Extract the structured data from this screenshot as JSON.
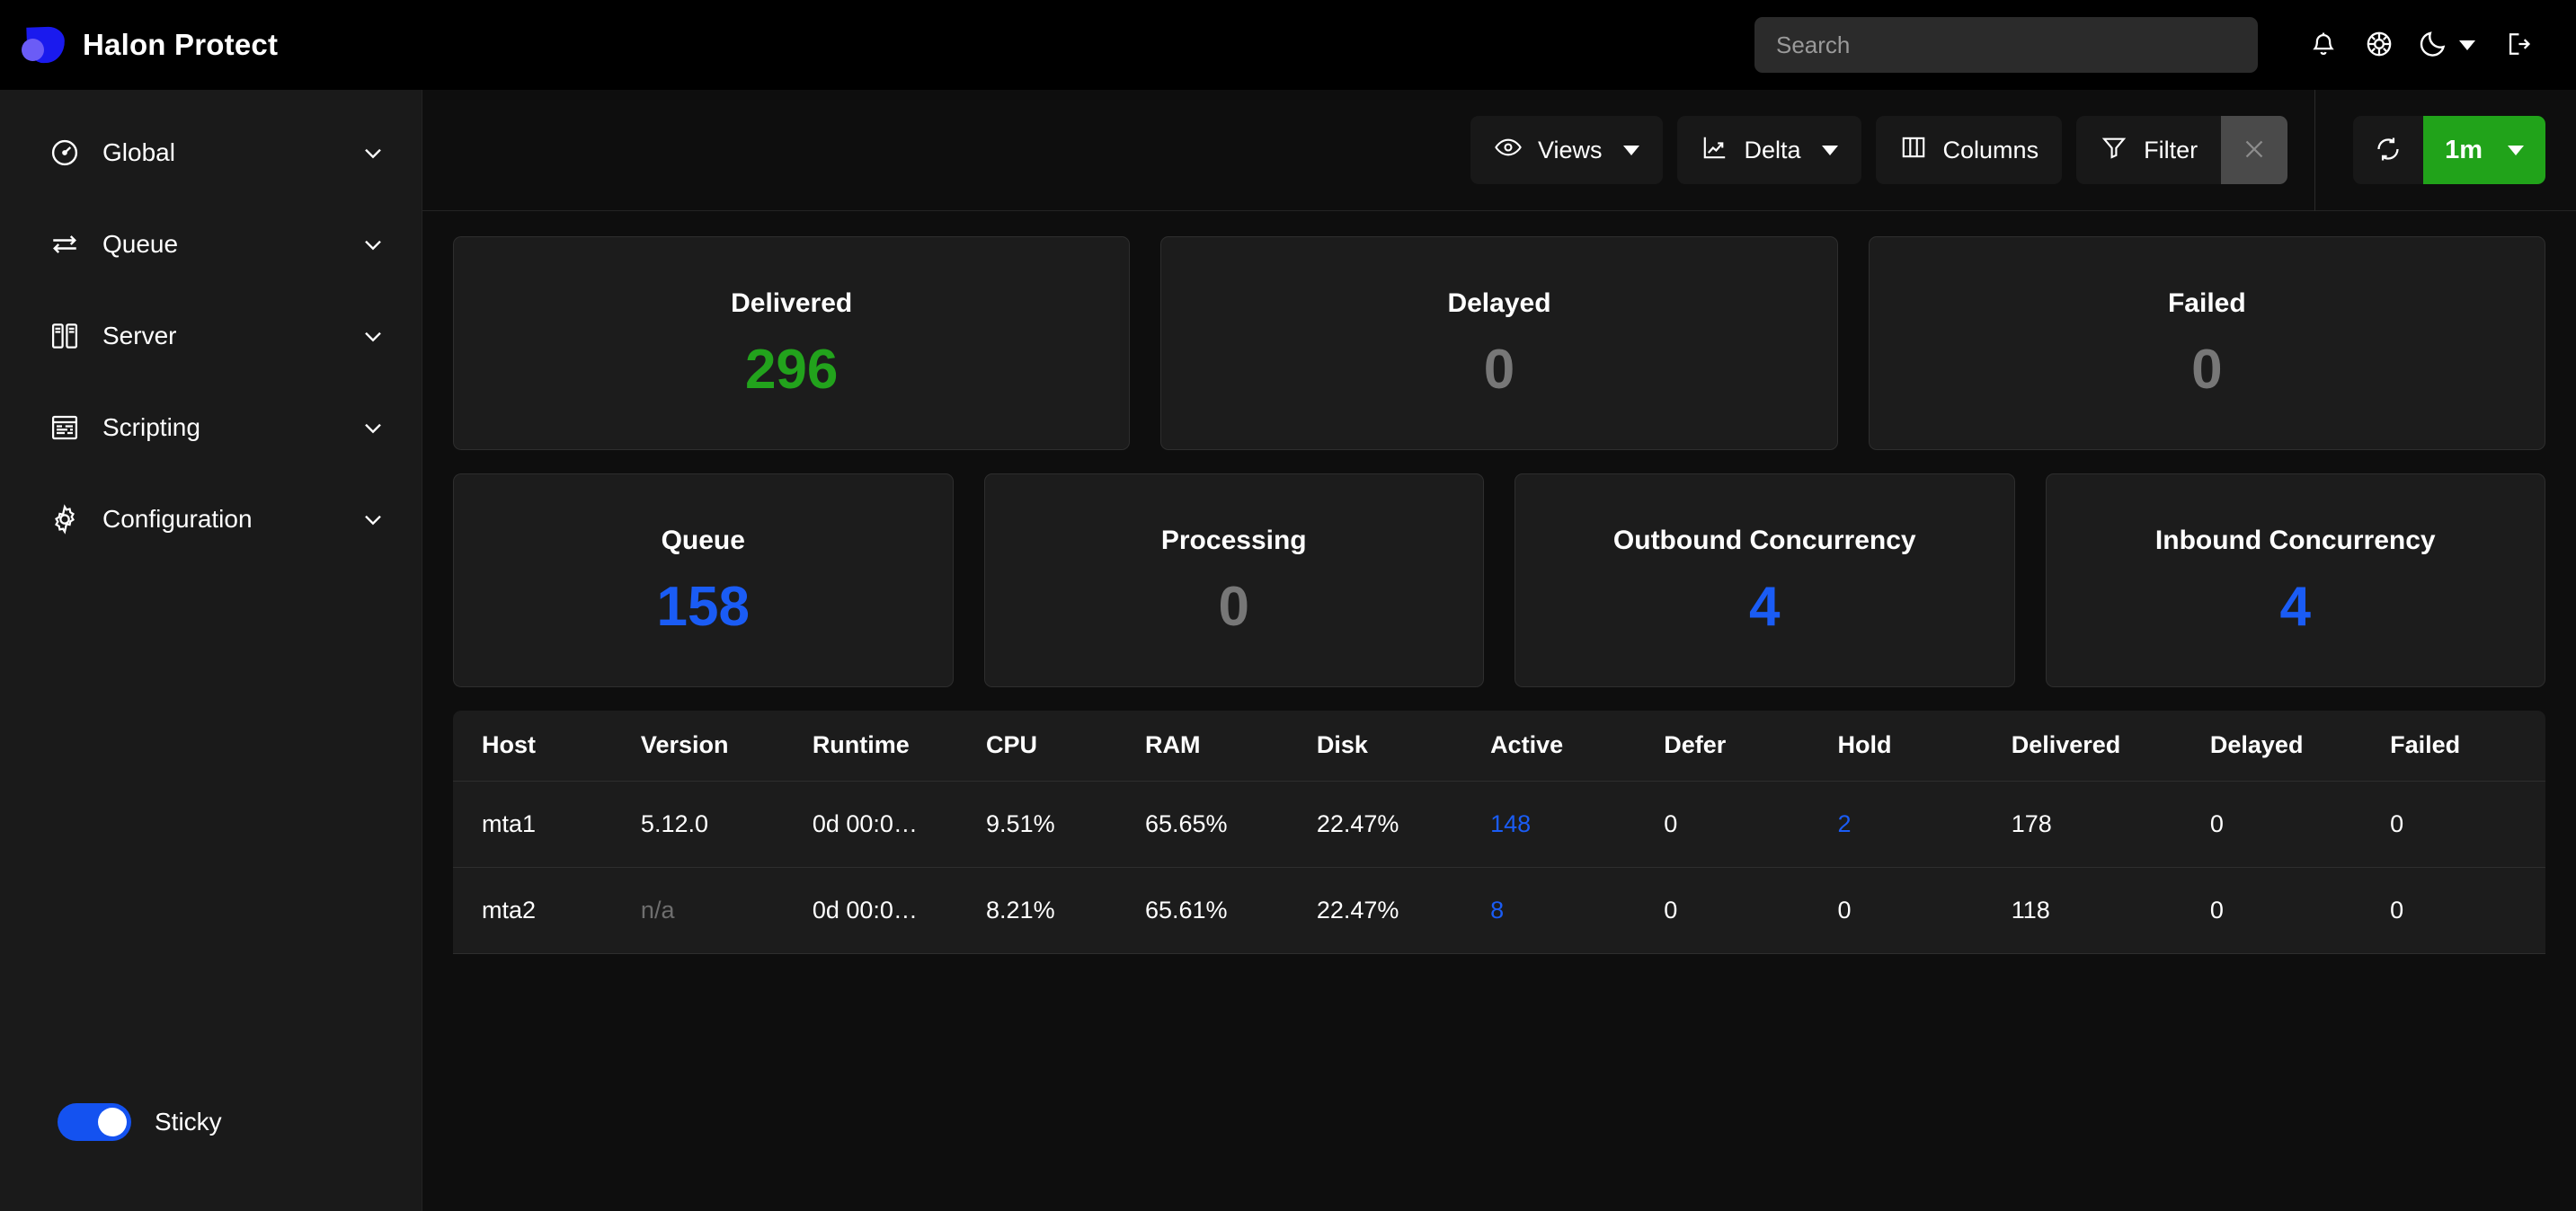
{
  "app": {
    "brand_title": "Halon Protect",
    "logo_color": "#1a1aee",
    "logo_dot_color": "#6b5cf6"
  },
  "header": {
    "search_placeholder": "Search",
    "search_value": "",
    "icons": {
      "notifications": "bell-icon",
      "help": "lifebuoy-icon",
      "theme": "moon-icon",
      "theme_caret": "chevron-down-icon",
      "logout": "logout-icon"
    }
  },
  "sidebar": {
    "items": [
      {
        "label": "Global",
        "icon": "gauge-icon"
      },
      {
        "label": "Queue",
        "icon": "swap-arrows-icon"
      },
      {
        "label": "Server",
        "icon": "servers-icon"
      },
      {
        "label": "Scripting",
        "icon": "script-window-icon"
      },
      {
        "label": "Configuration",
        "icon": "gear-icon"
      }
    ],
    "sticky": {
      "label": "Sticky",
      "enabled": true,
      "color": "#1452f0"
    }
  },
  "toolbar": {
    "views_label": "Views",
    "delta_label": "Delta",
    "columns_label": "Columns",
    "filter_label": "Filter",
    "filter_clear_label": "×",
    "refresh_icon": "refresh-icon",
    "interval_label": "1m",
    "interval_color": "#21a31a"
  },
  "stats": {
    "row1": [
      {
        "title": "Delivered",
        "value": "296",
        "tone": "green"
      },
      {
        "title": "Delayed",
        "value": "0",
        "tone": "gray"
      },
      {
        "title": "Failed",
        "value": "0",
        "tone": "gray"
      }
    ],
    "row2": [
      {
        "title": "Queue",
        "value": "158",
        "tone": "blue"
      },
      {
        "title": "Processing",
        "value": "0",
        "tone": "gray"
      },
      {
        "title": "Outbound Concurrency",
        "value": "4",
        "tone": "blue"
      },
      {
        "title": "Inbound Concurrency",
        "value": "4",
        "tone": "blue"
      }
    ]
  },
  "table": {
    "columns": [
      "Host",
      "Version",
      "Runtime",
      "CPU",
      "RAM",
      "Disk",
      "Active",
      "Defer",
      "Hold",
      "Delivered",
      "Delayed",
      "Failed"
    ],
    "rows": [
      {
        "host": "mta1",
        "version": "5.12.0",
        "runtime": "0d 00:0…",
        "cpu": "9.51%",
        "ram": "65.65%",
        "disk": "22.47%",
        "active": "148",
        "defer": "0",
        "hold": "2",
        "delivered": "178",
        "delayed": "0",
        "failed": "0",
        "version_muted": false,
        "active_link": true,
        "hold_link": true
      },
      {
        "host": "mta2",
        "version": "n/a",
        "runtime": "0d 00:0…",
        "cpu": "8.21%",
        "ram": "65.61%",
        "disk": "22.47%",
        "active": "8",
        "defer": "0",
        "hold": "0",
        "delivered": "118",
        "delayed": "0",
        "failed": "0",
        "version_muted": true,
        "active_link": true,
        "hold_link": false
      }
    ]
  }
}
